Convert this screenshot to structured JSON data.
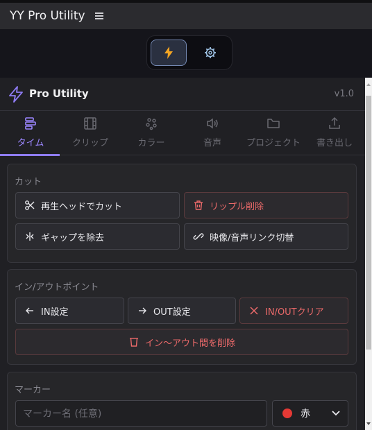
{
  "window": {
    "title": "YY Pro Utility",
    "menu_icon": "hamburger-icon"
  },
  "mode_switch": {
    "modes": [
      {
        "name": "quick",
        "icon": "bolt-icon",
        "active": true
      },
      {
        "name": "settings",
        "icon": "gear-icon",
        "active": false
      }
    ],
    "colors": {
      "bolt": "#f5a623",
      "gear": "#9fc3e6"
    }
  },
  "panel": {
    "title": "Pro Utility",
    "version": "v1.0",
    "accent": "#8f7cf5",
    "tabs": [
      {
        "label": "タイム",
        "icon": "timeline-icon",
        "active": true
      },
      {
        "label": "クリップ",
        "icon": "film-icon",
        "active": false
      },
      {
        "label": "カラー",
        "icon": "palette-icon",
        "active": false
      },
      {
        "label": "音声",
        "icon": "speaker-icon",
        "active": false
      },
      {
        "label": "プロジェクト",
        "icon": "folder-icon",
        "active": false
      },
      {
        "label": "書き出し",
        "icon": "export-icon",
        "active": false
      }
    ]
  },
  "cut": {
    "title": "カット",
    "buttons": {
      "cut_playhead": "再生ヘッドでカット",
      "ripple_delete": "リップル削除",
      "remove_gap": "ギャップを除去",
      "toggle_link": "映像/音声リンク切替"
    }
  },
  "inout": {
    "title": "イン/アウトポイント",
    "buttons": {
      "set_in": "IN設定",
      "set_out": "OUT設定",
      "clear": "IN/OUTクリア",
      "delete_range": "イン〜アウト間を削除"
    }
  },
  "marker": {
    "title": "マーカー",
    "name_placeholder": "マーカー名 (任意)",
    "color_value": "赤",
    "color_swatch": "#e53935"
  }
}
